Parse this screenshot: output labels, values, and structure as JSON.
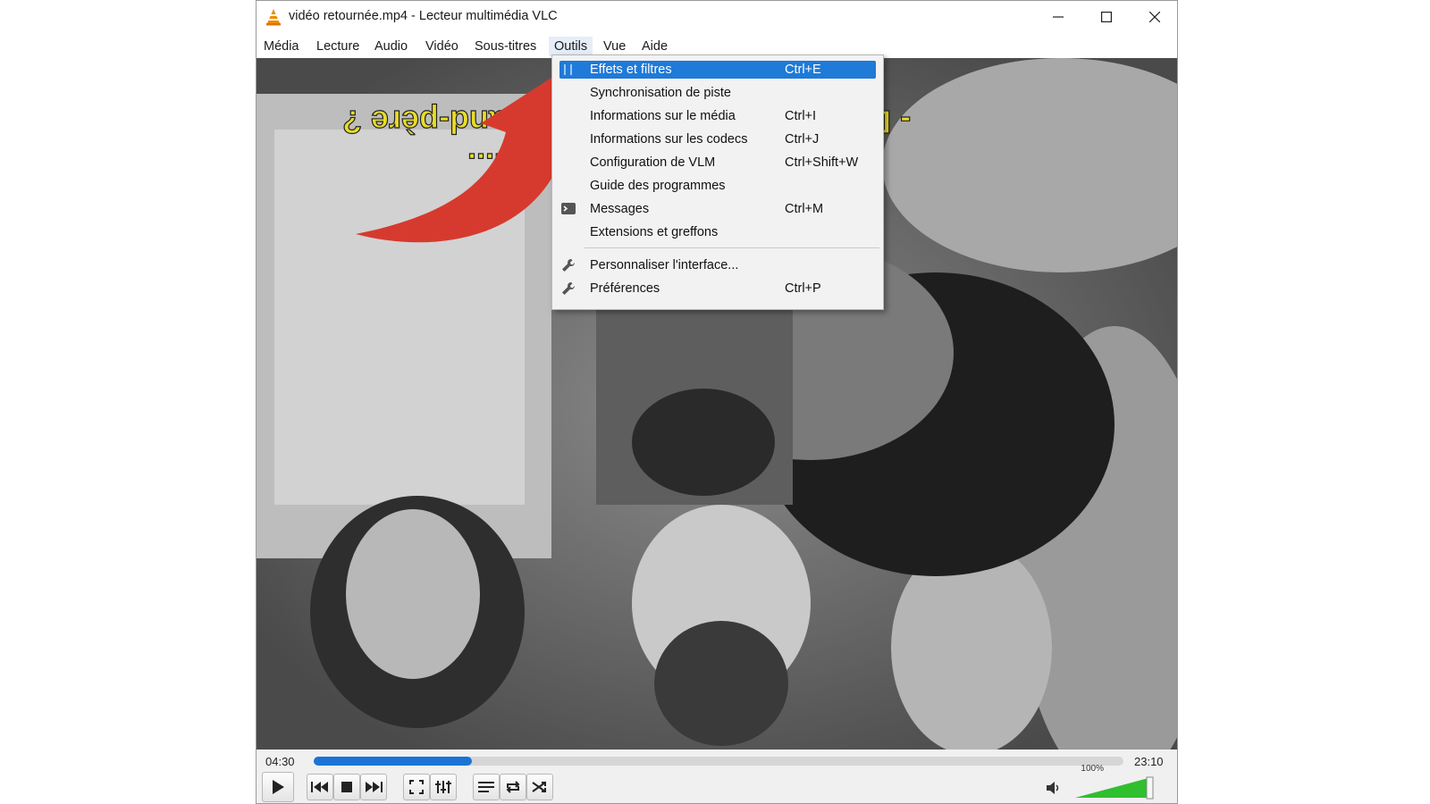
{
  "window": {
    "title": "vidéo retournée.mp4 - Lecteur multimédia VLC",
    "app_icon": "vlc-cone-icon",
    "buttons": [
      "minimize-icon",
      "maximize-icon",
      "close-icon"
    ]
  },
  "menubar": {
    "items": [
      {
        "label": "Média"
      },
      {
        "label": "Lecture"
      },
      {
        "label": "Audio"
      },
      {
        "label": "Vidéo"
      },
      {
        "label": "Sous-titres"
      },
      {
        "label": "Outils"
      },
      {
        "label": "Vue"
      },
      {
        "label": "Aide"
      }
    ],
    "open_menu": "Outils"
  },
  "tools_menu": {
    "items": [
      {
        "label": "Effets et filtres",
        "shortcut": "Ctrl+E",
        "icon": "sliders-icon",
        "highlighted": true
      },
      {
        "label": "Synchronisation de piste",
        "shortcut": ""
      },
      {
        "label": "Informations sur le média",
        "shortcut": "Ctrl+I"
      },
      {
        "label": "Informations sur les codecs",
        "shortcut": "Ctrl+J"
      },
      {
        "label": "Configuration de VLM",
        "shortcut": "Ctrl+Shift+W"
      },
      {
        "label": "Guide des programmes",
        "shortcut": ""
      },
      {
        "label": "Messages",
        "shortcut": "Ctrl+M",
        "icon": "terminal-icon"
      },
      {
        "label": "Extensions et greffons",
        "shortcut": ""
      },
      {
        "label": "Personnaliser l'interface...",
        "shortcut": "",
        "icon": "wrench-icon"
      },
      {
        "label": "Préférences",
        "shortcut": "Ctrl+P",
        "icon": "wrench-icon"
      }
    ]
  },
  "video": {
    "subtitle_lines": [
      "- Dois-je ou pas appeler grand-père ?",
      "- En..."
    ],
    "orientation": "upside-down",
    "annotation": "red-curved-arrow pointing to Effets et filtres"
  },
  "playback": {
    "elapsed": "04:30",
    "total": "23:10",
    "progress_fraction": 0.195,
    "volume_label": "100%",
    "volume_fraction": 1.0,
    "accent_color": "#1a74d6",
    "volume_color": "#2fbf2f"
  },
  "controls": [
    "play-icon",
    "previous-icon",
    "stop-icon",
    "next-icon",
    "fullscreen-icon",
    "extended-settings-icon",
    "playlist-icon",
    "loop-icon",
    "shuffle-icon",
    "speaker-icon"
  ]
}
